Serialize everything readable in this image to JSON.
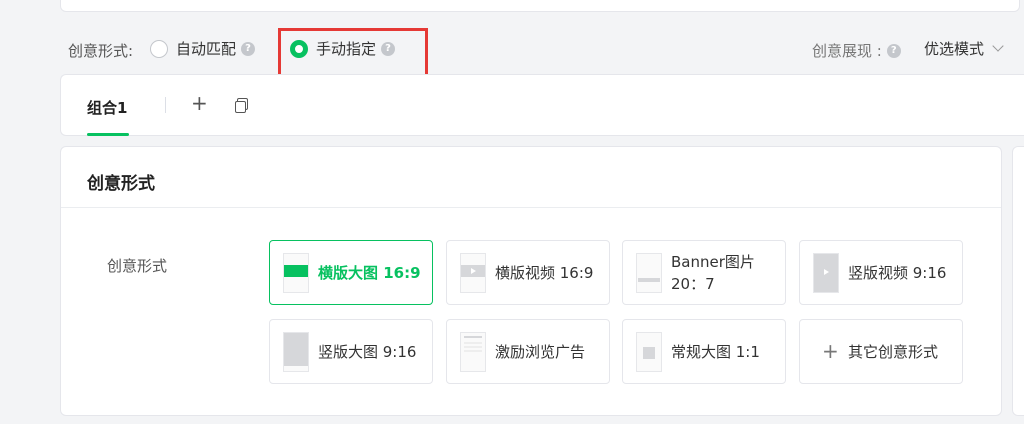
{
  "mode": {
    "label": "创意形式:",
    "options": [
      {
        "label": "自动匹配",
        "checked": false
      },
      {
        "label": "手动指定",
        "checked": true
      }
    ]
  },
  "display": {
    "label": "创意展现 :",
    "value": "优选模式"
  },
  "tabs": {
    "active_label": "组合1",
    "add_label": "+"
  },
  "section": {
    "title": "创意形式",
    "field_label": "创意形式"
  },
  "formats": [
    {
      "label": "横版大图 16:9",
      "selected": true
    },
    {
      "label": "横版视频 16:9",
      "selected": false
    },
    {
      "label": "Banner图片 20：7",
      "selected": false
    },
    {
      "label": "竖版视频 9:16",
      "selected": false
    },
    {
      "label": "竖版大图 9:16",
      "selected": false
    },
    {
      "label": "激励浏览广告",
      "selected": false
    },
    {
      "label": "常规大图 1:1",
      "selected": false
    },
    {
      "label": "其它创意形式",
      "selected": false
    }
  ],
  "colors": {
    "accent": "#07c160",
    "highlight": "#e53935"
  }
}
